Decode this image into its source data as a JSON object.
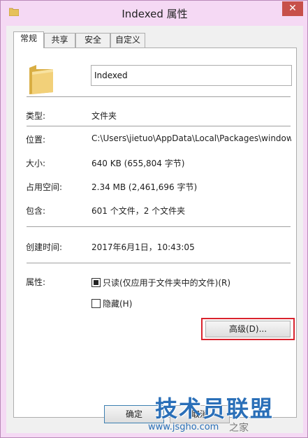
{
  "window": {
    "title": "Indexed 属性",
    "close_glyph": "✕"
  },
  "tabs": [
    {
      "label": "常规",
      "active": true
    },
    {
      "label": "共享",
      "active": false
    },
    {
      "label": "安全",
      "active": false
    },
    {
      "label": "自定义",
      "active": false
    }
  ],
  "general": {
    "name_value": "Indexed",
    "rows": {
      "type": {
        "label": "类型:",
        "value": "文件夹"
      },
      "location": {
        "label": "位置:",
        "value": "C:\\Users\\jietuo\\AppData\\Local\\Packages\\window"
      },
      "size": {
        "label": "大小:",
        "value": "640 KB (655,804 字节)"
      },
      "size_on_disk": {
        "label": "占用空间:",
        "value": "2.34 MB (2,461,696 字节)"
      },
      "contains": {
        "label": "包含:",
        "value": "601 个文件，2 个文件夹"
      },
      "created": {
        "label": "创建时间:",
        "value": "2017年6月1日，10:43:05"
      }
    },
    "attributes": {
      "label": "属性:",
      "readonly": {
        "label": "只读(仅应用于文件夹中的文件)(R)",
        "checked": true
      },
      "hidden": {
        "label": "隐藏(H)",
        "checked": false
      },
      "advanced_button": "高级(D)..."
    }
  },
  "footer": {
    "ok_button": "确定",
    "cancel_button": "取消"
  },
  "watermark": {
    "brand": "技术员联盟",
    "url": "www.jsgho.com",
    "tail": "之家"
  },
  "colors": {
    "frame": "#f5d9f4",
    "close_button": "#c7504a",
    "highlight": "#d9232d",
    "folder": "#e6c15a",
    "watermark": "#2a6fb8"
  },
  "icons": {
    "title": "folder-icon",
    "main": "folder-icon",
    "close": "close-icon"
  }
}
